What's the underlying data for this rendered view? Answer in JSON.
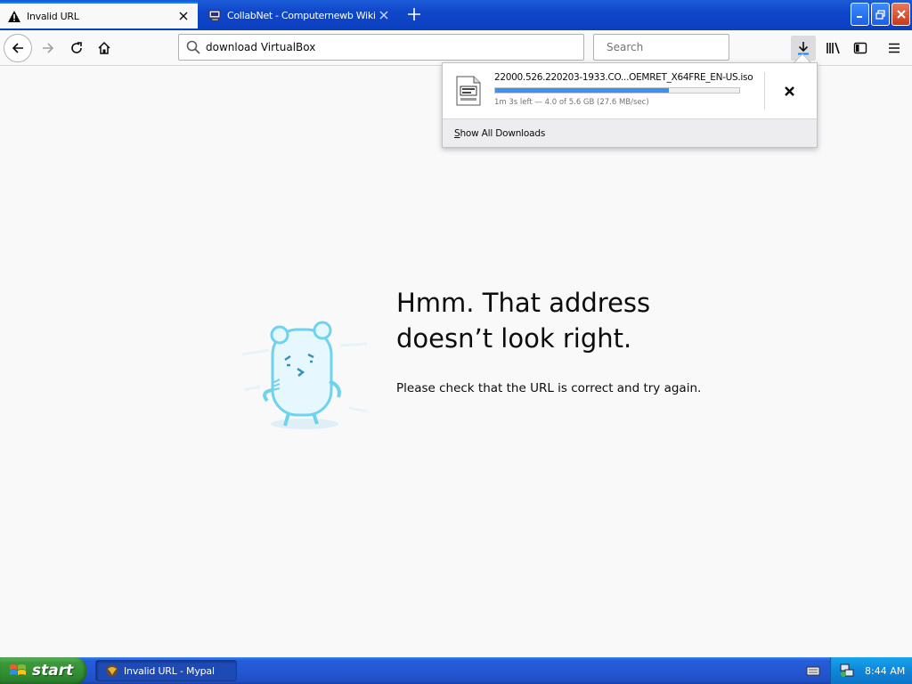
{
  "browser": {
    "tabs": [
      {
        "title": "Invalid URL",
        "icon": "warning-icon",
        "active": true
      },
      {
        "title": "CollabNet - Computernewb Wiki",
        "icon": "collabnet-icon",
        "active": false
      }
    ],
    "url_value": "download VirtualBox",
    "search_placeholder": "Search"
  },
  "downloads_panel": {
    "filename": "22000.526.220203-1933.CO...OEMRET_X64FRE_EN-US.iso",
    "status": "1m 3s left — 4.0 of 5.6 GB (27.6 MB/sec)",
    "progress_percent": 71,
    "show_all_label": "Show All Downloads"
  },
  "error_page": {
    "title_line1": "Hmm. That address",
    "title_line2": "doesn’t look right.",
    "description": "Please check that the URL is correct and try again."
  },
  "taskbar": {
    "start_label": "start",
    "task_item_label": "Invalid URL - Mypal",
    "clock": "8:44 AM"
  },
  "colors": {
    "accent": "#0a84ff",
    "progress": "#3d8ff2",
    "titlebar": "#0f46c9",
    "start_green": "#3b9a3b"
  }
}
